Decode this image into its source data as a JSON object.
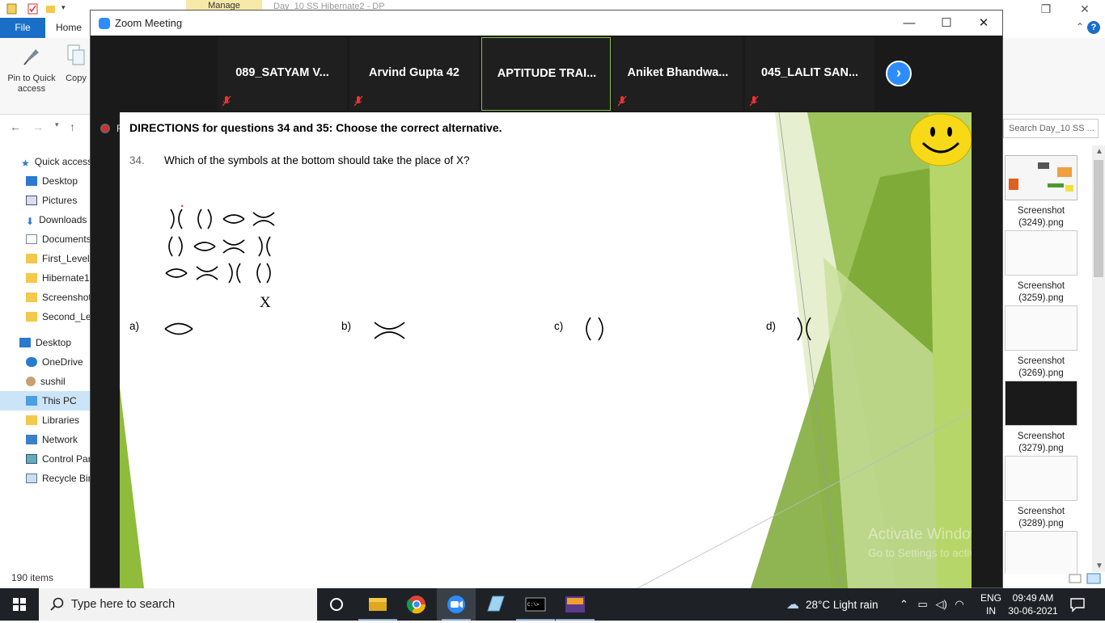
{
  "explorer": {
    "manage_tab": "Manage",
    "window_title": "Day_10 SS Hibernate2 - DP",
    "ribbon_tabs": {
      "file": "File",
      "home": "Home"
    },
    "ribbon_buttons": {
      "pin": "Pin to Quick access",
      "copy": "Copy"
    },
    "search_placeholder": "Search Day_10 SS ...",
    "nav_items": [
      {
        "label": "Quick access",
        "icon": "star-icon"
      },
      {
        "label": "Desktop",
        "icon": "desktop-icon"
      },
      {
        "label": "Pictures",
        "icon": "pictures-icon"
      },
      {
        "label": "Downloads",
        "icon": "download-icon"
      },
      {
        "label": "Documents",
        "icon": "documents-icon"
      },
      {
        "label": "First_Level_",
        "icon": "folder-icon"
      },
      {
        "label": "Hibernate1",
        "icon": "folder-icon"
      },
      {
        "label": "Screenshot",
        "icon": "folder-icon"
      },
      {
        "label": "Second_Lev",
        "icon": "folder-icon"
      },
      {
        "label": "Desktop",
        "icon": "desktop-icon"
      },
      {
        "label": "OneDrive",
        "icon": "cloud-icon"
      },
      {
        "label": "sushil",
        "icon": "user-icon"
      },
      {
        "label": "This PC",
        "icon": "pc-icon"
      },
      {
        "label": "Libraries",
        "icon": "libraries-icon"
      },
      {
        "label": "Network",
        "icon": "network-icon"
      },
      {
        "label": "Control Par",
        "icon": "control-panel-icon"
      },
      {
        "label": "Recycle Bin",
        "icon": "recycle-bin-icon"
      }
    ],
    "item_count": "190 items",
    "thumbnails": [
      {
        "name": "Screenshot",
        "num": "(3249).png"
      },
      {
        "name": "Screenshot",
        "num": "(3259).png"
      },
      {
        "name": "Screenshot",
        "num": "(3269).png"
      },
      {
        "name": "Screenshot",
        "num": "(3279).png"
      },
      {
        "name": "Screenshot",
        "num": "(3289).png"
      }
    ]
  },
  "zoom": {
    "title": "Zoom Meeting",
    "participants": [
      {
        "name": "089_SATYAM V...",
        "muted": true
      },
      {
        "name": "Arvind Gupta 42",
        "muted": true
      },
      {
        "name": "APTITUDE TRAI...",
        "muted": false,
        "active": true
      },
      {
        "name": "Aniket  Bhandwa...",
        "muted": true
      },
      {
        "name": "045_LALIT SAN...",
        "muted": true
      }
    ],
    "recording_label": "R"
  },
  "slide": {
    "directions": "DIRECTIONS for questions 34 and 35: Choose the correct alternative.",
    "question_number": "34.",
    "question_text": "Which of the symbols at the bottom should take the place of X?",
    "x_label": "X",
    "options": [
      {
        "label": "a)",
        "symbol": "lens"
      },
      {
        "label": "b)",
        "symbol": "x-curve"
      },
      {
        "label": "c)",
        "symbol": "parens"
      },
      {
        "label": "d)",
        "symbol": "back-parens"
      }
    ],
    "watermark_line1": "Activate Windows",
    "watermark_line2": "Go to Settings to activate Windows.",
    "colors": {
      "green_dark": "#7aa832",
      "green_light": "#b7d66a"
    }
  },
  "taskbar": {
    "search_placeholder": "Type here to search",
    "weather": "28°C  Light rain",
    "lang_line1": "ENG",
    "lang_line2": "IN",
    "time": "09:49 AM",
    "date": "30-06-2021"
  }
}
